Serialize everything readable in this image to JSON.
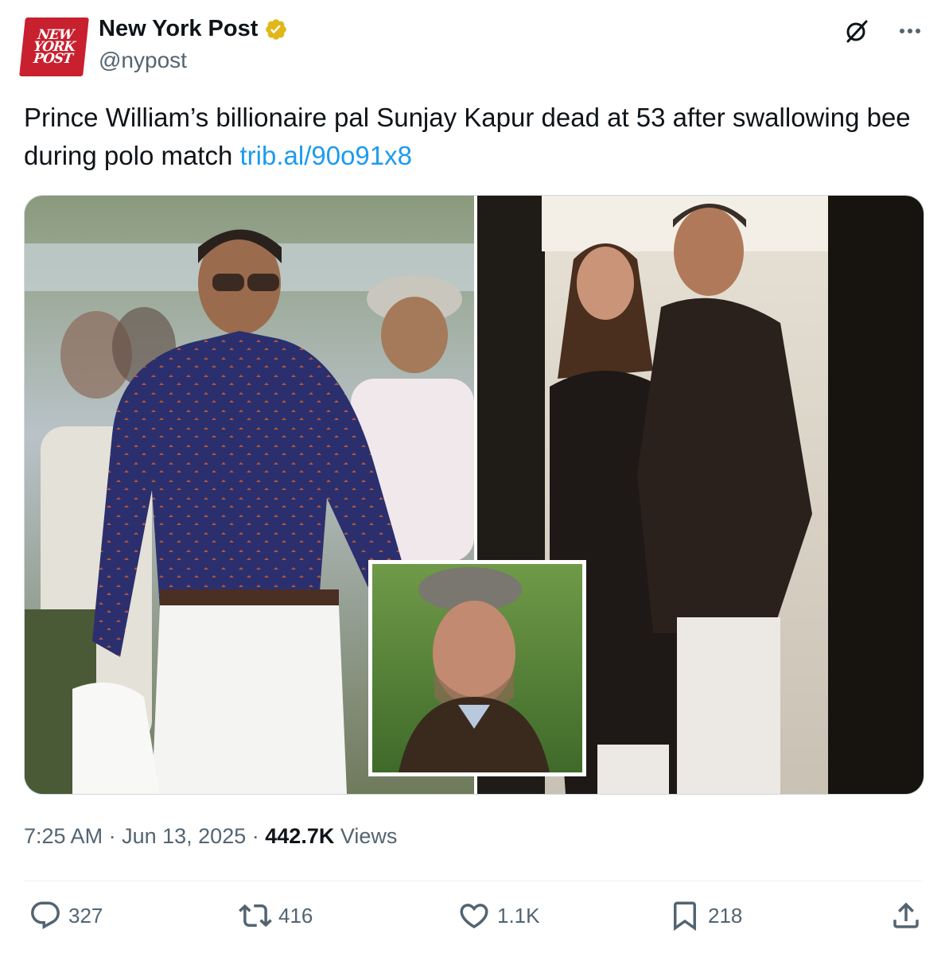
{
  "author": {
    "logo_lines": [
      "NEW",
      "YORK",
      "POST"
    ],
    "name": "New York Post",
    "handle": "@nypost",
    "verified_badge_color": "#e2b719"
  },
  "tweet": {
    "text": "Prince William’s billionaire pal Sunjay Kapur dead at 53 after swallowing bee during polo match ",
    "link": "trib.al/90o91x8",
    "link_color": "#1d9bf0"
  },
  "meta": {
    "time": "7:25 AM",
    "date": "Jun 13, 2025",
    "views_count": "442.7K",
    "views_label": "Views",
    "separator": "·"
  },
  "actions": {
    "replies": "327",
    "reposts": "416",
    "likes": "1.1K",
    "bookmarks": "218"
  },
  "icons": [
    "verified-badge-icon",
    "grok-icon",
    "more-icon",
    "reply-icon",
    "repost-icon",
    "like-icon",
    "bookmark-icon",
    "share-icon"
  ]
}
